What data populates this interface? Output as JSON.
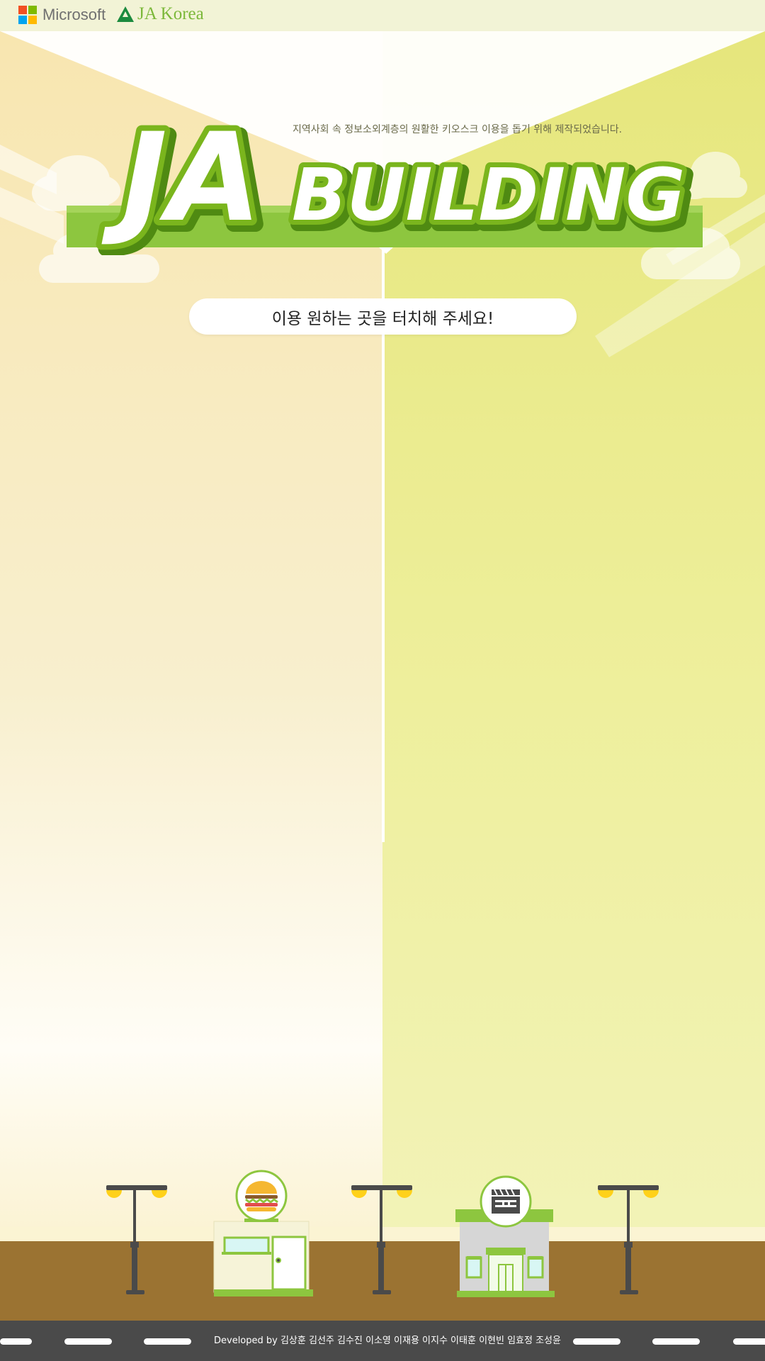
{
  "header": {
    "microsoft_label": "Microsoft",
    "ja_korea_label": "JA Korea"
  },
  "hero": {
    "tagline": "지역사회 속 정보소외계층의 원활한 키오스크 이용을 돕기 위해 제작되었습니다.",
    "logo_ja": "JA",
    "logo_building": "BUILDING"
  },
  "prompt": {
    "touch_label": "이용 원하는 곳을 터치해 주세요!"
  },
  "street": {
    "shops": [
      {
        "icon": "hamburger-icon"
      },
      {
        "icon": "clapperboard-icon"
      }
    ]
  },
  "footer": {
    "credits": "Developed by 김상훈 김선주 김수진 이소영 이재용 이지수 이태훈 이현빈 임효정 조성윤"
  },
  "colors": {
    "brand_green": "#8dc63f",
    "dark_green": "#6aa322",
    "ground_brown": "#9b7332",
    "road_gray": "#4a4a4a",
    "left_bg": "#f8e6b0",
    "right_bg": "#e6e67c"
  }
}
